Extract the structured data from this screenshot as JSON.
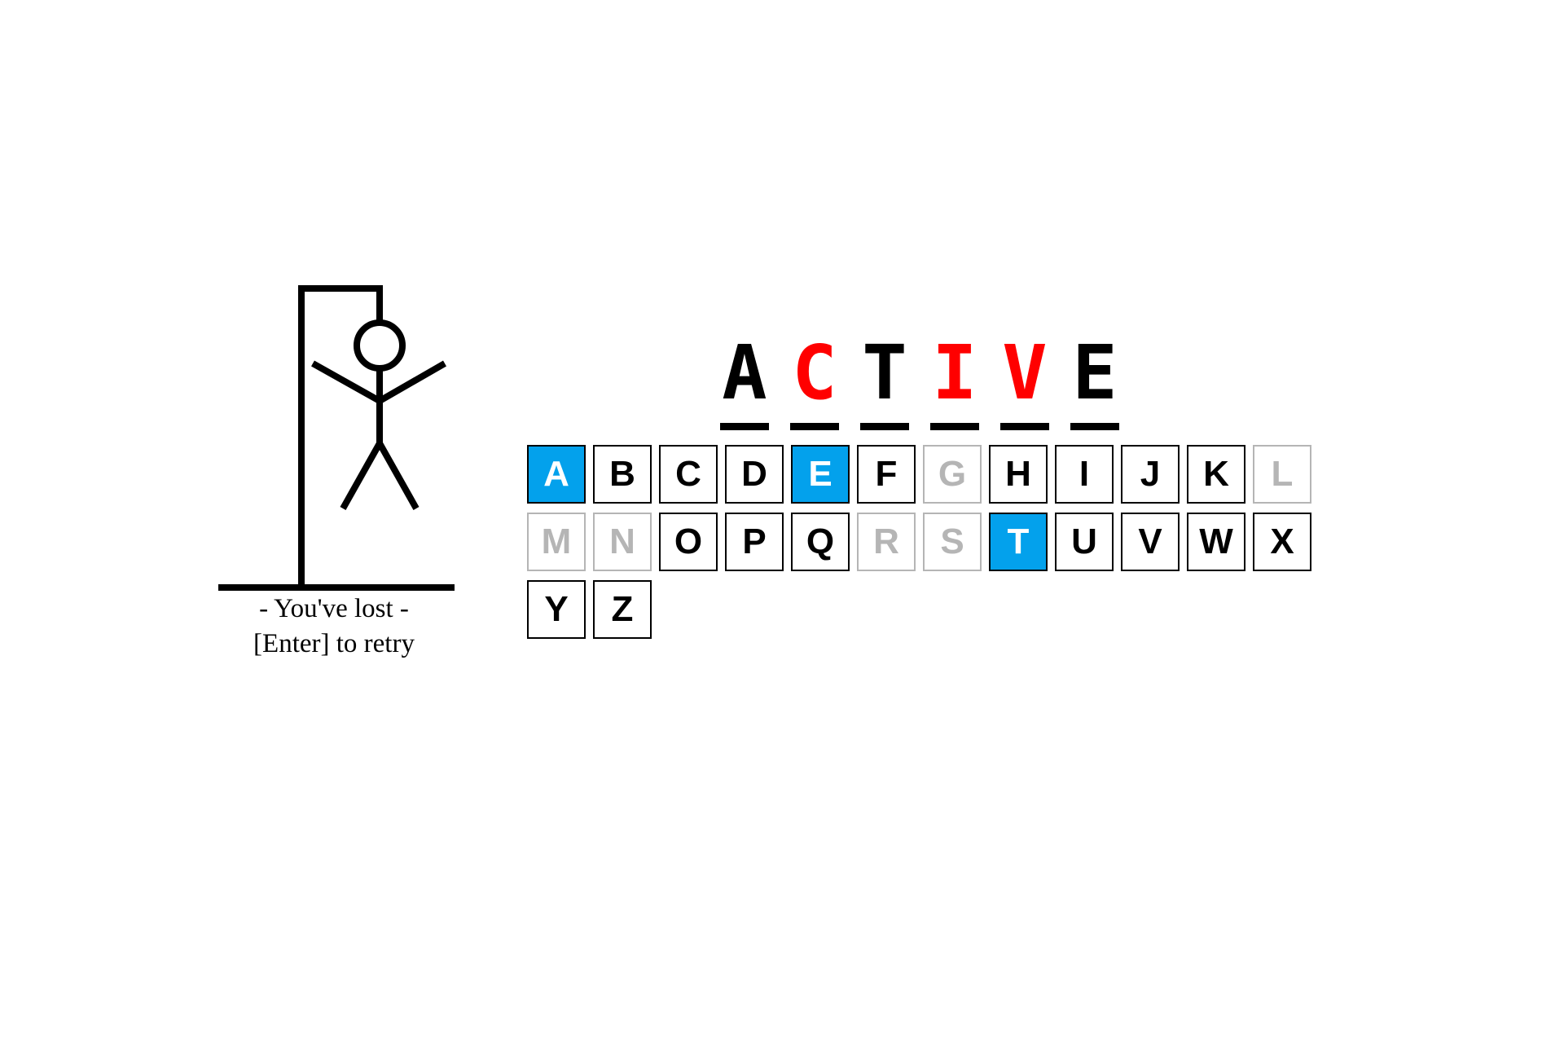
{
  "game": {
    "status_line": "- You've lost -",
    "retry_line": "[Enter] to retry",
    "word": [
      {
        "letter": "A",
        "color": "#000000"
      },
      {
        "letter": "C",
        "color": "#ff0000"
      },
      {
        "letter": "T",
        "color": "#000000"
      },
      {
        "letter": "I",
        "color": "#ff0000"
      },
      {
        "letter": "V",
        "color": "#ff0000"
      },
      {
        "letter": "E",
        "color": "#000000"
      }
    ],
    "keys": [
      {
        "letter": "A",
        "state": "correct"
      },
      {
        "letter": "B",
        "state": "available"
      },
      {
        "letter": "C",
        "state": "available"
      },
      {
        "letter": "D",
        "state": "available"
      },
      {
        "letter": "E",
        "state": "correct"
      },
      {
        "letter": "F",
        "state": "available"
      },
      {
        "letter": "G",
        "state": "disabled"
      },
      {
        "letter": "H",
        "state": "available"
      },
      {
        "letter": "I",
        "state": "available"
      },
      {
        "letter": "J",
        "state": "available"
      },
      {
        "letter": "K",
        "state": "available"
      },
      {
        "letter": "L",
        "state": "disabled"
      },
      {
        "letter": "M",
        "state": "disabled"
      },
      {
        "letter": "N",
        "state": "disabled"
      },
      {
        "letter": "O",
        "state": "available"
      },
      {
        "letter": "P",
        "state": "available"
      },
      {
        "letter": "Q",
        "state": "available"
      },
      {
        "letter": "R",
        "state": "disabled"
      },
      {
        "letter": "S",
        "state": "disabled"
      },
      {
        "letter": "T",
        "state": "correct"
      },
      {
        "letter": "U",
        "state": "available"
      },
      {
        "letter": "V",
        "state": "available"
      },
      {
        "letter": "W",
        "state": "available"
      },
      {
        "letter": "X",
        "state": "available"
      },
      {
        "letter": "Y",
        "state": "available"
      },
      {
        "letter": "Z",
        "state": "available"
      }
    ]
  },
  "colors": {
    "correct_key": "#03a1ec",
    "missed_letter": "#ff0000",
    "disabled_key": "#b5b5b5"
  }
}
